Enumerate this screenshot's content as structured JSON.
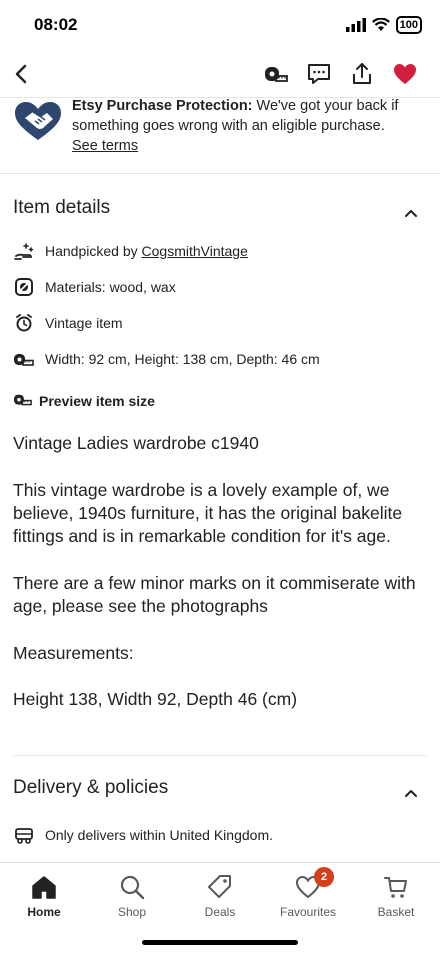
{
  "status_bar": {
    "time": "08:02",
    "battery": "100"
  },
  "nav": {
    "back_icon": "chevron-left-icon",
    "actions": [
      "tape-measure-icon",
      "message-icon",
      "share-icon",
      "heart-filled-icon"
    ],
    "accent_color": "#d1203f"
  },
  "protection": {
    "title": "Etsy Purchase Protection:",
    "body": " We've got your back if something goes wrong with an eligible purchase.",
    "link": "See terms"
  },
  "item_details": {
    "title": "Item details",
    "handpicked_prefix": "Handpicked by ",
    "handpicked_shop": "CogsmithVintage",
    "materials": "Materials: wood, wax",
    "vintage": "Vintage item",
    "dimensions": "Width: 92 cm, Height: 138 cm, Depth: 46 cm",
    "preview_label": "Preview item size"
  },
  "description": {
    "paragraphs": [
      "Vintage Ladies wardrobe c1940",
      "This vintage wardrobe is a lovely example of, we believe, 1940s furniture, it has the original bakelite fittings and is in remarkable condition for it's age.",
      "There are a few minor marks on it commiserate with age, please see the photographs",
      "Measurements:",
      "Height 138, Width 92, Depth 46 (cm)"
    ]
  },
  "delivery": {
    "title": "Delivery & policies",
    "note": "Only delivers within United Kingdom."
  },
  "tabs": [
    {
      "label": "Home",
      "icon": "home-icon",
      "active": true
    },
    {
      "label": "Shop",
      "icon": "search-icon"
    },
    {
      "label": "Deals",
      "icon": "tag-icon"
    },
    {
      "label": "Favourites",
      "icon": "heart-outline-icon",
      "badge": "2"
    },
    {
      "label": "Basket",
      "icon": "cart-icon"
    }
  ],
  "colors": {
    "badge": "#d1421c",
    "heart": "#d1203f"
  }
}
